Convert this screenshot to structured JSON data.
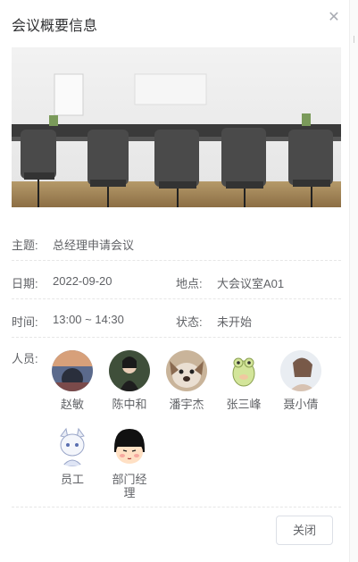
{
  "dialog": {
    "title": "会议概要信息",
    "close_icon": "close-icon",
    "image_alt": "meeting-room-photo"
  },
  "fields": {
    "subject_label": "主题:",
    "subject": "总经理申请会议",
    "date_label": "日期:",
    "date": "2022-09-20",
    "location_label": "地点:",
    "location": "大会议室A01",
    "time_label": "时间:",
    "time": "13:00 ~ 14:30",
    "status_label": "状态:",
    "status": "未开始"
  },
  "people": {
    "label": "人员:",
    "list": [
      {
        "name": "赵敏"
      },
      {
        "name": "陈中和"
      },
      {
        "name": "潘宇杰"
      },
      {
        "name": "张三峰"
      },
      {
        "name": "聂小倩"
      },
      {
        "name": "员工"
      },
      {
        "name": "部门经理"
      }
    ]
  },
  "footer": {
    "close_label": "关闭"
  }
}
